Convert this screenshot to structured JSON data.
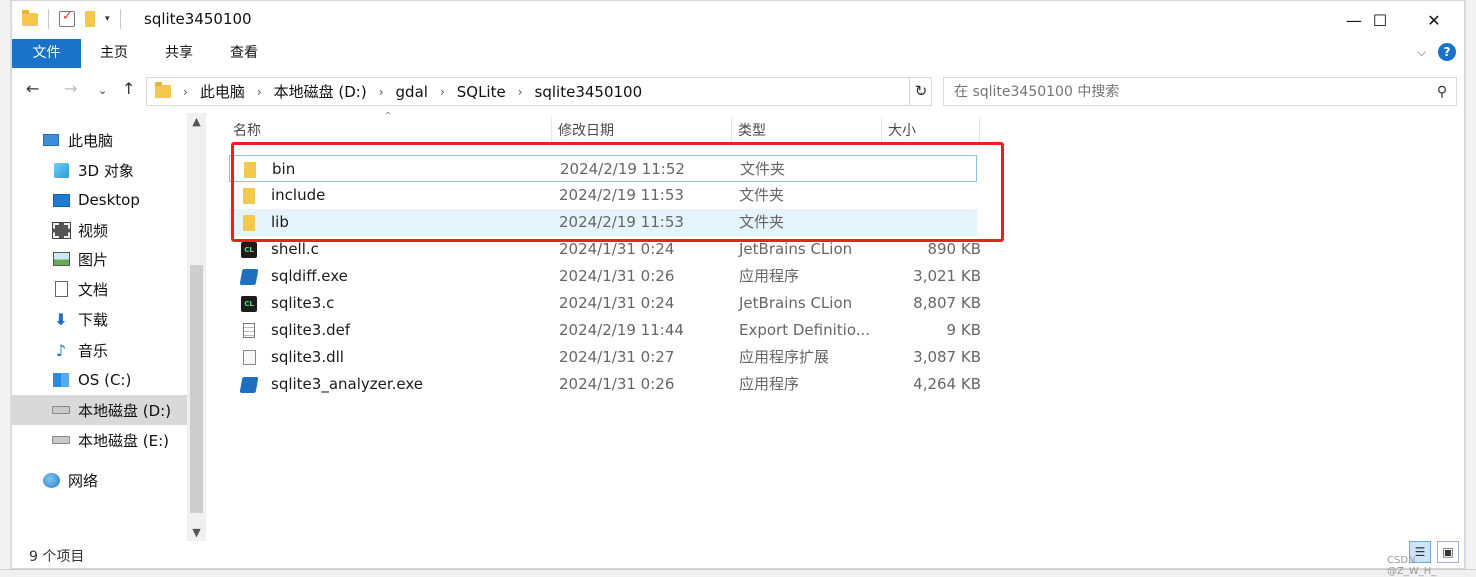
{
  "window": {
    "title": "sqlite3450100",
    "minimize_glyph": "—",
    "maximize_glyph": "☐",
    "close_glyph": "✕"
  },
  "ribbon": {
    "tabs": [
      "文件",
      "主页",
      "共享",
      "查看"
    ]
  },
  "address": {
    "crumbs": [
      "此电脑",
      "本地磁盘 (D:)",
      "gdal",
      "SQLite",
      "sqlite3450100"
    ],
    "search_placeholder": "在 sqlite3450100 中搜索"
  },
  "navpane": {
    "items": [
      {
        "label": "此电脑",
        "icon": "pc-icon"
      },
      {
        "label": "3D 对象",
        "icon": "3d-objects-icon"
      },
      {
        "label": "Desktop",
        "icon": "desktop-icon"
      },
      {
        "label": "视频",
        "icon": "video-icon"
      },
      {
        "label": "图片",
        "icon": "picture-icon"
      },
      {
        "label": "文档",
        "icon": "document-icon"
      },
      {
        "label": "下载",
        "icon": "download-icon"
      },
      {
        "label": "音乐",
        "icon": "music-icon"
      },
      {
        "label": "OS (C:)",
        "icon": "os-drive-icon"
      },
      {
        "label": "本地磁盘 (D:)",
        "icon": "drive-icon",
        "selected": true
      },
      {
        "label": "本地磁盘 (E:)",
        "icon": "drive-icon"
      },
      {
        "label": "网络",
        "icon": "network-icon"
      }
    ]
  },
  "columns": {
    "name": "名称",
    "date": "修改日期",
    "type": "类型",
    "size": "大小"
  },
  "files": [
    {
      "name": "bin",
      "date": "2024/2/19 11:52",
      "type": "文件夹",
      "size": "",
      "icon": "folder-icon"
    },
    {
      "name": "include",
      "date": "2024/2/19 11:53",
      "type": "文件夹",
      "size": "",
      "icon": "folder-icon"
    },
    {
      "name": "lib",
      "date": "2024/2/19 11:53",
      "type": "文件夹",
      "size": "",
      "icon": "folder-icon"
    },
    {
      "name": "shell.c",
      "date": "2024/1/31 0:24",
      "type": "JetBrains CLion",
      "size": "890 KB",
      "icon": "clion-file-icon"
    },
    {
      "name": "sqldiff.exe",
      "date": "2024/1/31 0:26",
      "type": "应用程序",
      "size": "3,021 KB",
      "icon": "exe-icon"
    },
    {
      "name": "sqlite3.c",
      "date": "2024/1/31 0:24",
      "type": "JetBrains CLion",
      "size": "8,807 KB",
      "icon": "clion-file-icon"
    },
    {
      "name": "sqlite3.def",
      "date": "2024/2/19 11:44",
      "type": "Export Definitio...",
      "size": "9 KB",
      "icon": "def-file-icon"
    },
    {
      "name": "sqlite3.dll",
      "date": "2024/1/31 0:27",
      "type": "应用程序扩展",
      "size": "3,087 KB",
      "icon": "dll-file-icon"
    },
    {
      "name": "sqlite3_analyzer.exe",
      "date": "2024/1/31 0:26",
      "type": "应用程序",
      "size": "4,264 KB",
      "icon": "exe-icon"
    }
  ],
  "status": {
    "count": "9 个项目"
  },
  "watermark": "CSDN @Z_W_H_",
  "colors": {
    "accent": "#1a73c9",
    "highlight_box": "#e8231e"
  }
}
